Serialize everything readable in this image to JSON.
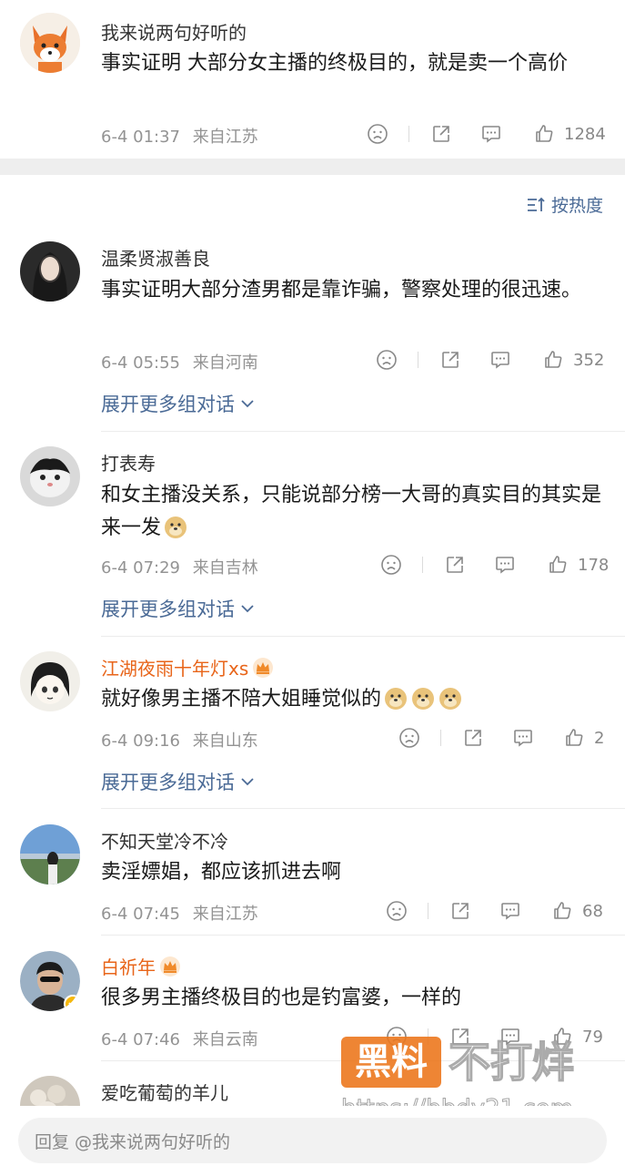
{
  "top_comment": {
    "username": "我来说两句好听的",
    "text": "事实证明 大部分女主播的终极目的，就是卖一个高价",
    "time": "6-4 01:37",
    "location": "来自江苏",
    "likes": "1284"
  },
  "sort": {
    "label": "按热度"
  },
  "comments": [
    {
      "username": "温柔贤淑善良",
      "text": "事实证明大部分渣男都是靠诈骗，警察处理的很迅速。",
      "time": "6-4 05:55",
      "location": "来自河南",
      "likes": "352",
      "expand": "展开更多组对话"
    },
    {
      "username": "打表寿",
      "text": "和女主播没关系，只能说部分榜一大哥的真实目的其实是来一发",
      "time": "6-4 07:29",
      "location": "来自吉林",
      "likes": "178",
      "expand": "展开更多组对话"
    },
    {
      "username": "江湖夜雨十年灯xs",
      "text": "就好像男主播不陪大姐睡觉似的",
      "time": "6-4 09:16",
      "location": "来自山东",
      "likes": "2",
      "expand": "展开更多组对话"
    },
    {
      "username": "不知天堂冷不冷",
      "text": "卖淫嫖娼，都应该抓进去啊",
      "time": "6-4 07:45",
      "location": "来自江苏",
      "likes": "68"
    },
    {
      "username": "白祈年",
      "text": "很多男主播终极目的也是钓富婆，一样的",
      "time": "6-4 07:46",
      "location": "来自云南",
      "likes": "79"
    },
    {
      "username": "爱吃葡萄的羊儿"
    }
  ],
  "reply": {
    "placeholder": "回复 @我来说两句好听的"
  },
  "watermark": {
    "badge": "黑料",
    "text": "不打烊",
    "url": "https://bbdy21.com"
  },
  "colors": {
    "link": "#4a6a96",
    "vip_name": "#e8651a",
    "meta": "#939393",
    "watermark": "#ec781e"
  }
}
